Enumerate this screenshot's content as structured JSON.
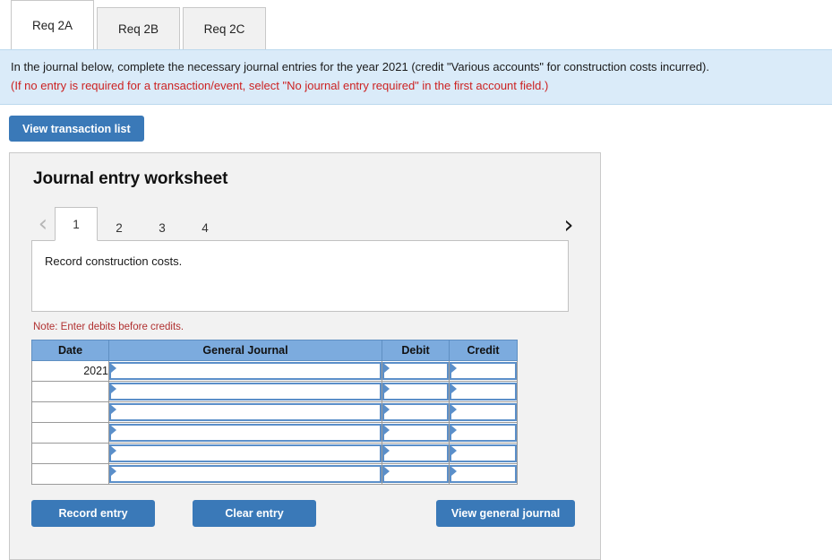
{
  "req_tabs": [
    {
      "label": "Req 2A",
      "active": true
    },
    {
      "label": "Req 2B",
      "active": false
    },
    {
      "label": "Req 2C",
      "active": false
    }
  ],
  "instruction": {
    "line1": "In the journal below, complete the necessary journal entries for the year 2021 (credit \"Various accounts\" for construction costs incurred).",
    "line2": "(If no entry is required for a transaction/event, select \"No journal entry required\" in the first account field.)",
    "line1_color": "#1b1b1b",
    "line2_color": "#cc2222",
    "background_color": "#daebf9"
  },
  "toolbar": {
    "view_transaction_list_label": "View transaction list"
  },
  "worksheet": {
    "title": "Journal entry worksheet",
    "pager": {
      "prev_icon": "chevron-left",
      "next_icon": "chevron-right",
      "prev_glyph": "‹",
      "next_glyph": "›",
      "pages": [
        "1",
        "2",
        "3",
        "4"
      ],
      "active_page": "1"
    },
    "description": "Record construction costs.",
    "note": "Note: Enter debits before credits.",
    "table": {
      "headers": [
        "Date",
        "General Journal",
        "Debit",
        "Credit"
      ],
      "rows": [
        {
          "date": "2021",
          "general_journal": "",
          "debit": "",
          "credit": ""
        },
        {
          "date": "",
          "general_journal": "",
          "debit": "",
          "credit": ""
        },
        {
          "date": "",
          "general_journal": "",
          "debit": "",
          "credit": ""
        },
        {
          "date": "",
          "general_journal": "",
          "debit": "",
          "credit": ""
        },
        {
          "date": "",
          "general_journal": "",
          "debit": "",
          "credit": ""
        },
        {
          "date": "",
          "general_journal": "",
          "debit": "",
          "credit": ""
        }
      ],
      "header_color": "#7cabde"
    },
    "actions": {
      "record_entry_label": "Record entry",
      "clear_entry_label": "Clear entry",
      "view_general_journal_label": "View general journal"
    }
  },
  "colors": {
    "button_blue": "#3a79b8",
    "panel_background": "#f2f2f2",
    "note_red": "#b03030"
  }
}
